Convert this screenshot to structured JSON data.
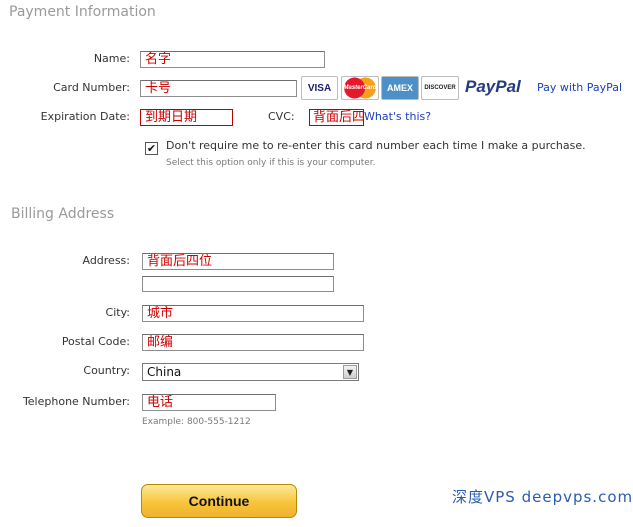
{
  "payment": {
    "title": "Payment Information",
    "name_label": "Name:",
    "name_value": "名字",
    "card_number_label": "Card Number:",
    "card_number_value": "卡号",
    "card_logos": [
      "VISA",
      "MasterCard",
      "AMEX",
      "DISCOVER",
      "PayPal"
    ],
    "paypal_link": "Pay with PayPal",
    "expiration_label": "Expiration Date:",
    "expiration_value": "到期日期",
    "cvc_label": "CVC:",
    "cvc_value": "背面后四位",
    "whats_this_link": "What's this?",
    "remember_checked": true,
    "remember_label": "Don't require me to re-enter this card number each time I make a purchase.",
    "remember_hint": "Select this option only if this is your computer."
  },
  "billing": {
    "title": "Billing Address",
    "address_label": "Address:",
    "address_line1_value": "背面后四位",
    "address_line2_value": "",
    "city_label": "City:",
    "city_value": "城市",
    "postal_label": "Postal Code:",
    "postal_value": "邮编",
    "country_label": "Country:",
    "country_value": "China",
    "telephone_label": "Telephone Number:",
    "telephone_value": "电话",
    "telephone_hint": "Example: 800-555-1212"
  },
  "actions": {
    "continue_label": "Continue"
  },
  "watermark": "深度VPS deepvps.com",
  "colors": {
    "field_text": "#cc0000",
    "link": "#1a3fbf",
    "section_title": "#9a9a9a",
    "button_gold": "#f7c53c"
  }
}
